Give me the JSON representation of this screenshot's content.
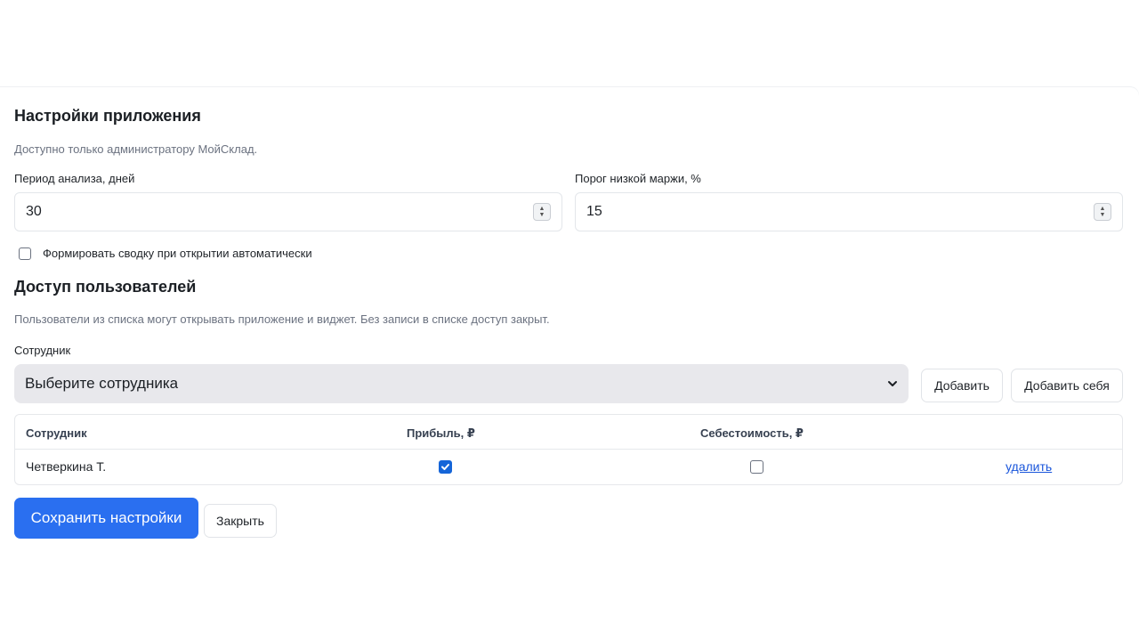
{
  "app_settings": {
    "title": "Настройки приложения",
    "subtitle": "Доступно только администратору МойСклад.",
    "period": {
      "label": "Период анализа, дней",
      "value": "30"
    },
    "margin": {
      "label": "Порог низкой маржи, %",
      "value": "15"
    },
    "auto_summary": {
      "label": "Формировать сводку при открытии автоматически",
      "checked": false
    }
  },
  "user_access": {
    "title": "Доступ пользователей",
    "subtitle": "Пользователи из списка могут открывать приложение и виджет. Без записи в списке доступ закрыт.",
    "employee_label": "Сотрудник",
    "employee_select": {
      "selected": "Выберите сотрудника"
    },
    "add_button": "Добавить",
    "add_self_button": "Добавить себя",
    "table": {
      "columns": [
        "Сотрудник",
        "Прибыль, ₽",
        "Себестоимость, ₽"
      ],
      "rows": [
        {
          "name": "Четверкина Т.",
          "profit": true,
          "cost": false,
          "delete_label": "удалить"
        }
      ]
    }
  },
  "actions": {
    "save": "Сохранить настройки",
    "close": "Закрыть"
  },
  "colors": {
    "primary": "#2a6ff0",
    "link": "#1a56db",
    "checkbox_checked": "#1565d8",
    "select_bg": "#e8e8ec"
  }
}
